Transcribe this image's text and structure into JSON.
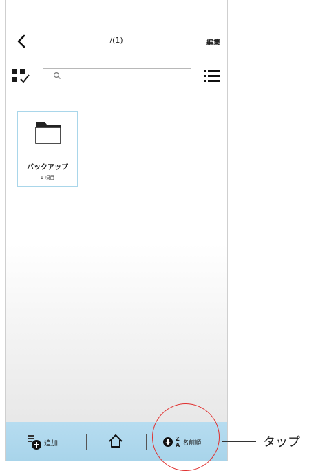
{
  "header": {
    "back_icon": "chevron-left-icon",
    "path_title": "/(1)",
    "edit_label": "編集"
  },
  "toolbar": {
    "select_icon": "multi-select-check-icon",
    "search_placeholder": "",
    "search_value": "",
    "search_icon": "search-icon",
    "list_view_icon": "list-view-icon"
  },
  "items": [
    {
      "icon": "folder-icon",
      "name": "バックアップ",
      "count": "1 項目"
    }
  ],
  "bottom_bar": {
    "add_label": "追加",
    "add_icon": "add-document-icon",
    "home_icon": "home-icon",
    "sort_icon": "sort-direction-icon",
    "sort_top": "Z",
    "sort_bottom": "A",
    "sort_label": "名前順"
  },
  "annotation": {
    "label": "タップ",
    "color": "#e0302f"
  },
  "colors": {
    "bottom_bar": "#b6dcf0",
    "tile_border": "#a9d6ea"
  }
}
